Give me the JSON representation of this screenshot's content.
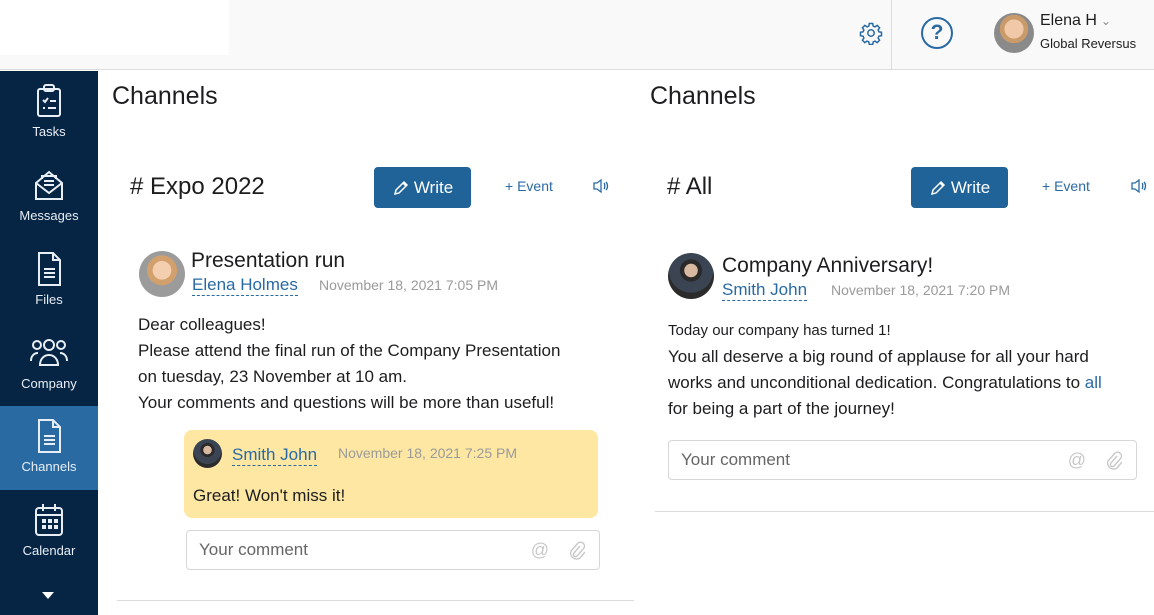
{
  "header": {
    "settings_icon": "gear-icon",
    "help_icon": "question-circle-icon",
    "help_glyph": "?",
    "user": {
      "name": "Elena H",
      "organization": "Global Reversus",
      "chevron": "⌄"
    }
  },
  "sidebar": {
    "items": [
      {
        "label": "Tasks",
        "icon": "clipboard-icon",
        "active": false
      },
      {
        "label": "Messages",
        "icon": "envelope-icon",
        "active": false
      },
      {
        "label": "Files",
        "icon": "document-icon",
        "active": false
      },
      {
        "label": "Company",
        "icon": "people-icon",
        "active": false
      },
      {
        "label": "Channels",
        "icon": "document-icon",
        "active": true
      },
      {
        "label": "Calendar",
        "icon": "calendar-icon",
        "active": false
      }
    ],
    "more_icon": "caret-down-icon"
  },
  "panels": [
    {
      "title": "Channels",
      "channel": "# Expo 2022",
      "write_label": "Write",
      "event_label": "+ Event",
      "post": {
        "title": "Presentation run",
        "author": "Elena Holmes",
        "date": "November 18, 2021 7:05 PM",
        "body": [
          "Dear colleagues!",
          "Please attend the final run of the Company Presentation",
          "on tuesday, 23 November at 10 am.",
          "Your comments and questions will be more than useful!"
        ],
        "reply": {
          "author": "Smith John",
          "date": "November 18, 2021 7:25 PM",
          "text": "Great! Won't miss it!"
        },
        "comment_placeholder": "Your comment",
        "mention_glyph": "@"
      }
    },
    {
      "title": "Channels",
      "channel": "# All",
      "write_label": "Write",
      "event_label": "+ Event",
      "post": {
        "title": "Company Anniversary!",
        "author": "Smith John",
        "date": "November 18, 2021 7:20 PM",
        "body_line1": "Today our company has turned 1!",
        "body_line2": "You all deserve a big round of applause for all your hard",
        "body_line3_pre": "works and unconditional dedication. Congratulations to ",
        "body_line3_link": "all",
        "body_line4": "for being a part of the journey!",
        "comment_placeholder": "Your comment",
        "mention_glyph": "@"
      }
    }
  ],
  "colors": {
    "sidebar": "#062443",
    "sidebar_active": "#2a6aa3",
    "accent": "#1f6399",
    "reply_bg": "#fde7a3"
  }
}
